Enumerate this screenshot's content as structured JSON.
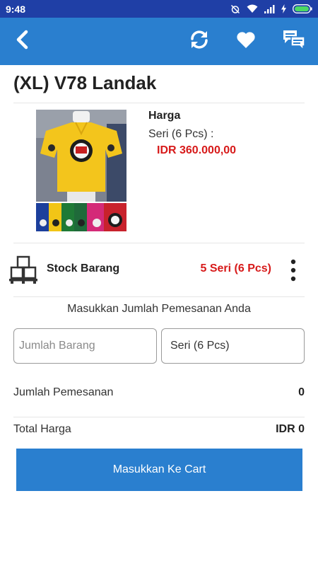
{
  "status_bar": {
    "time": "9:48",
    "icons": [
      "alarm-off-icon",
      "wifi-icon",
      "signal-icon",
      "charging-icon",
      "battery-icon"
    ]
  },
  "app_bar": {
    "background": "#2a7fcf",
    "icons": [
      "back-icon",
      "refresh-icon",
      "heart-icon",
      "chat-icon"
    ]
  },
  "product": {
    "title": "(XL) V78 Landak",
    "price_heading": "Harga",
    "price_unit": "Seri (6 Pcs) :",
    "price_value": "IDR 360.000,00",
    "color_variants": [
      "#1c3f9c",
      "#f2c516",
      "#1f7a36",
      "#d42a78",
      "#c8222c"
    ]
  },
  "stock": {
    "icon": "pallet-boxes-icon",
    "label": "Stock Barang",
    "value": "5 Seri (6 Pcs)"
  },
  "order": {
    "prompt": "Masukkan Jumlah Pemesanan Anda",
    "quantity_placeholder": "Jumlah Barang",
    "quantity_value": "",
    "unit_selected": "Seri (6 Pcs)"
  },
  "summary": {
    "order_count_label": "Jumlah Pemesanan",
    "order_count_value": "0",
    "total_label": "Total Harga",
    "total_value": "IDR 0"
  },
  "actions": {
    "add_to_cart_label": "Masukkan Ke Cart"
  },
  "colors": {
    "status_bar": "#1f3fa6",
    "accent": "#2a7fcf",
    "price": "#d71a1a"
  }
}
